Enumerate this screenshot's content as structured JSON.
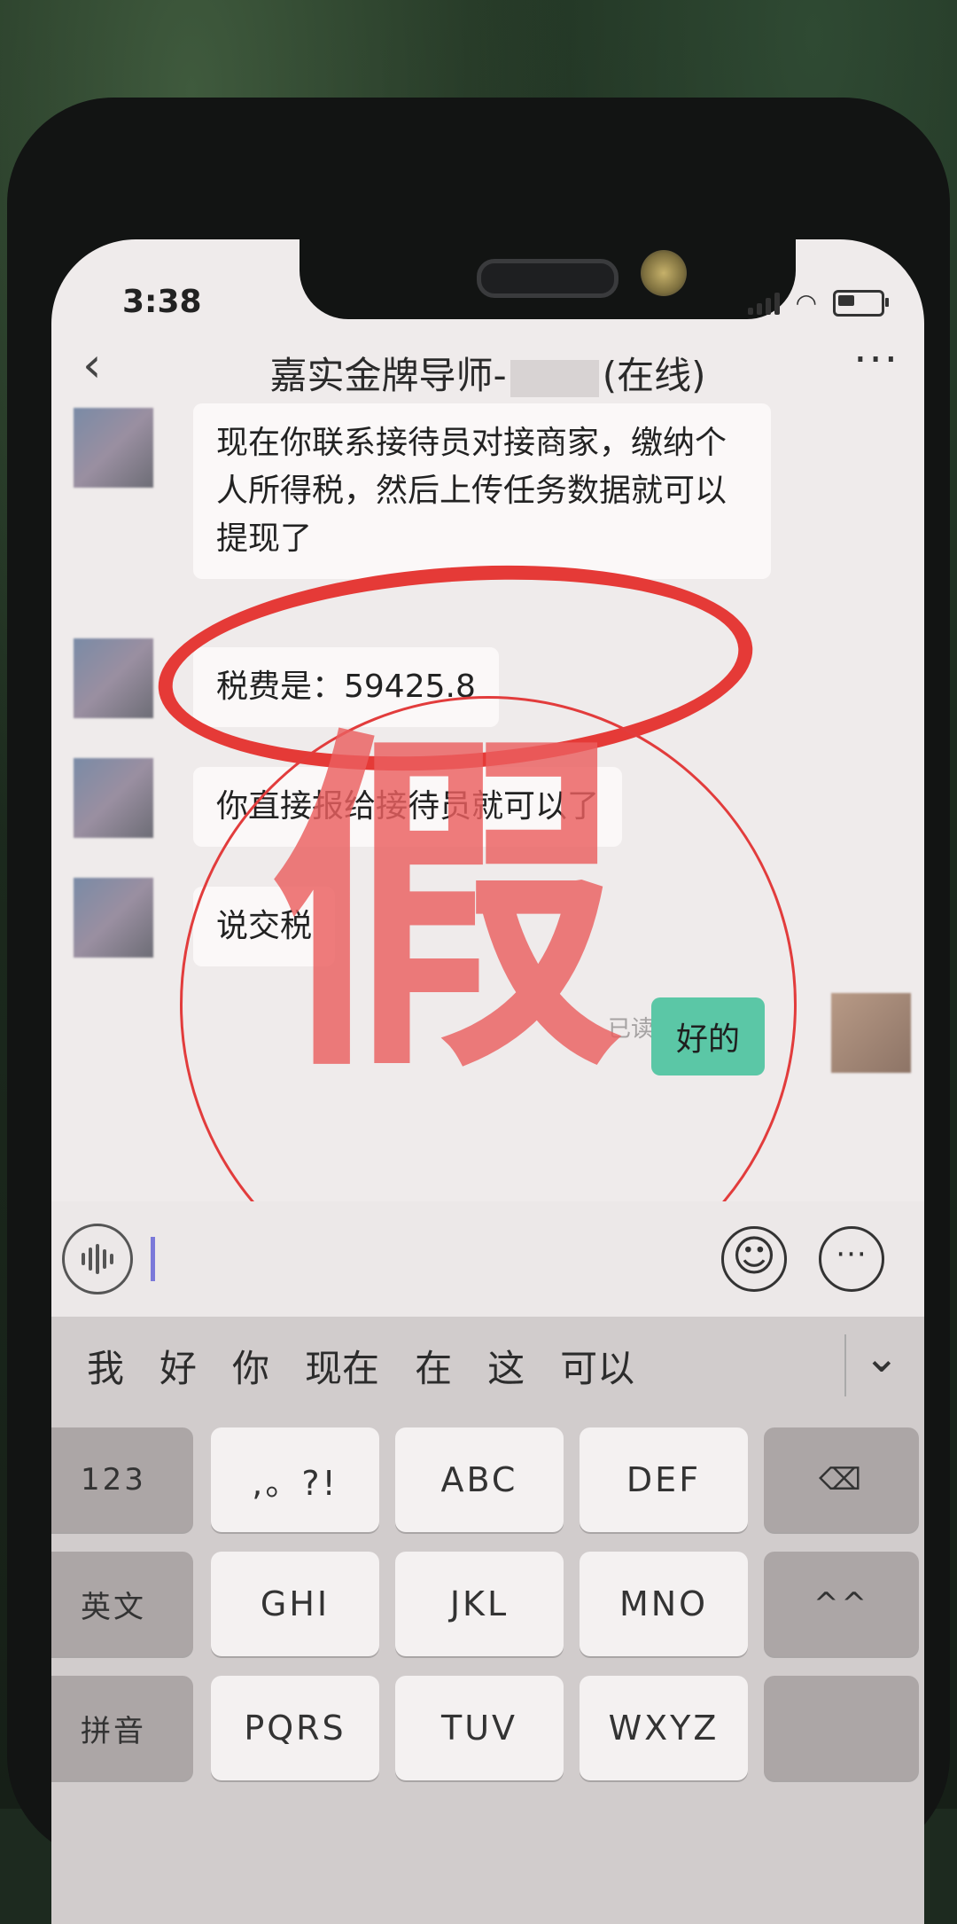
{
  "status": {
    "time": "3:38"
  },
  "header": {
    "back_icon": "chevron-left-icon",
    "title_prefix": "嘉实金牌导师-",
    "title_suffix": "(在线)",
    "more_icon": "ellipsis-icon"
  },
  "messages": [
    {
      "sender": "other",
      "text": "现在你联系接待员对接商家，缴纳个人所得税，然后上传任务数据就可以提现了"
    },
    {
      "sender": "other",
      "text": "税费是：59425.8"
    },
    {
      "sender": "other",
      "text": "你直接报给接待员就可以了"
    },
    {
      "sender": "other",
      "text": "说交税"
    },
    {
      "sender": "self",
      "text": "好的",
      "status": "已读"
    }
  ],
  "overlay": {
    "stamp_text": "假",
    "stamp_color": "#e23c3c",
    "ellipse_color": "#e53a37"
  },
  "input_bar": {
    "voice_icon": "voice-wave-icon",
    "emoji_icon": "emoji-smile-icon",
    "more_icon": "more-circle-icon"
  },
  "keyboard": {
    "candidates": [
      "我",
      "好",
      "你",
      "现在",
      "在",
      "这",
      "可以"
    ],
    "collapse_icon": "chevron-down-icon",
    "rows": [
      [
        "123",
        ",。?!",
        "ABC",
        "DEF",
        "⌫"
      ],
      [
        "英文",
        "GHI",
        "JKL",
        "MNO",
        "^^"
      ],
      [
        "拼音",
        "PQRS",
        "TUV",
        "WXYZ",
        ""
      ]
    ]
  },
  "colors": {
    "self_bubble": "#5bc7a6",
    "other_bubble": "#fbf8f8"
  }
}
